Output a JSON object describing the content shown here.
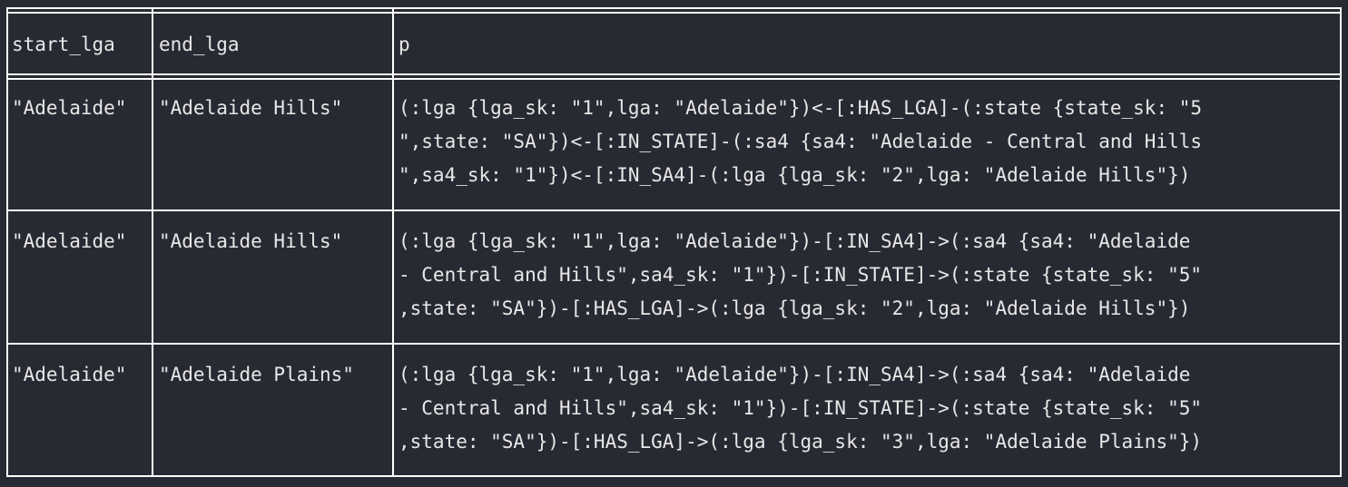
{
  "table": {
    "headers": [
      "start_lga",
      "end_lga",
      "p"
    ],
    "rows": [
      {
        "start_lga": "\"Adelaide\"",
        "end_lga": "\"Adelaide Hills\"",
        "p_lines": [
          "(:lga {lga_sk: \"1\",lga: \"Adelaide\"})<-[:HAS_LGA]-(:state {state_sk: \"5",
          "\",state: \"SA\"})<-[:IN_STATE]-(:sa4 {sa4: \"Adelaide - Central and Hills",
          "\",sa4_sk: \"1\"})<-[:IN_SA4]-(:lga {lga_sk: \"2\",lga: \"Adelaide Hills\"})"
        ]
      },
      {
        "start_lga": "\"Adelaide\"",
        "end_lga": "\"Adelaide Hills\"",
        "p_lines": [
          "(:lga {lga_sk: \"1\",lga: \"Adelaide\"})-[:IN_SA4]->(:sa4 {sa4: \"Adelaide",
          "- Central and Hills\",sa4_sk: \"1\"})-[:IN_STATE]->(:state {state_sk: \"5\"",
          ",state: \"SA\"})-[:HAS_LGA]->(:lga {lga_sk: \"2\",lga: \"Adelaide Hills\"})"
        ]
      },
      {
        "start_lga": "\"Adelaide\"",
        "end_lga": "\"Adelaide Plains\"",
        "p_lines": [
          "(:lga {lga_sk: \"1\",lga: \"Adelaide\"})-[:IN_SA4]->(:sa4 {sa4: \"Adelaide",
          "- Central and Hills\",sa4_sk: \"1\"})-[:IN_STATE]->(:state {state_sk: \"5\"",
          ",state: \"SA\"})-[:HAS_LGA]->(:lga {lga_sk: \"3\",lga: \"Adelaide Plains\"})"
        ]
      }
    ]
  },
  "colors": {
    "background": "#282a33",
    "border": "#ffffff",
    "text": "#e8e8e8"
  }
}
